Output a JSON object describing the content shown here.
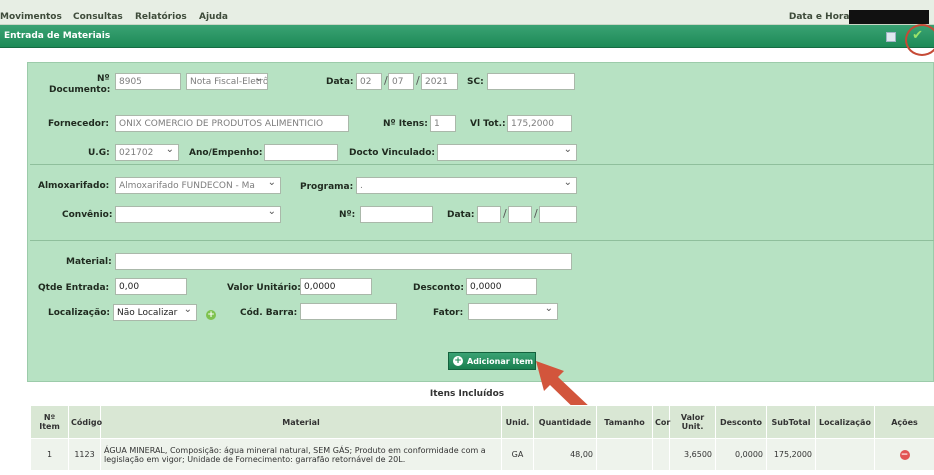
{
  "menu": {
    "items": [
      "Movimentos",
      "Consultas",
      "Relatórios",
      "Ajuda"
    ],
    "date_label": "Data e Hora:"
  },
  "window": {
    "title": "Entrada de Materiais"
  },
  "form": {
    "documento": {
      "label_num": "Nº",
      "label_doc": "Documento:",
      "value": "8905",
      "tipo": "Nota Fiscal-Eletrôr"
    },
    "data": {
      "label": "Data:",
      "dia": "02",
      "mes": "07",
      "ano": "2021"
    },
    "sc": {
      "label": "SC:",
      "value": ""
    },
    "fornecedor": {
      "label": "Fornecedor:",
      "value": "ONIX COMERCIO DE PRODUTOS ALIMENTICIO"
    },
    "n_itens": {
      "label": "Nº Itens:",
      "value": "1"
    },
    "vl_tot": {
      "label": "Vl Tot.:",
      "value": "175,2000"
    },
    "ug": {
      "label": "U.G:",
      "value": "021702"
    },
    "ano_empenho": {
      "label": "Ano/Empenho:",
      "value": ""
    },
    "docto_vinculado": {
      "label": "Docto Vinculado:",
      "value": ""
    },
    "almoxarifado": {
      "label": "Almoxarifado:",
      "value": "Almoxarifado FUNDECON - Ma"
    },
    "programa": {
      "label": "Programa:",
      "value": "."
    },
    "convenio": {
      "label": "Convênio:",
      "value": ""
    },
    "conv_num": {
      "label": "Nº:",
      "value": ""
    },
    "conv_data": {
      "label": "Data:"
    },
    "material": {
      "label": "Material:",
      "value": ""
    },
    "qtde_entrada": {
      "label": "Qtde Entrada:",
      "value": "0,00"
    },
    "valor_unitario": {
      "label": "Valor Unitário:",
      "value": "0,0000"
    },
    "desconto": {
      "label": "Desconto:",
      "value": "0,0000"
    },
    "localizacao": {
      "label": "Localização:",
      "value": "Não Localizar"
    },
    "cod_barra": {
      "label": "Cód. Barra:",
      "value": ""
    },
    "fator": {
      "label": "Fator:",
      "value": ""
    },
    "add_button": "Adicionar Item"
  },
  "itens": {
    "title": "Itens Incluídos",
    "headers": [
      "Nº Item",
      "Código",
      "Material",
      "Unid.",
      "Quantidade",
      "Tamanho",
      "Cor",
      "Valor Unit.",
      "Desconto",
      "SubTotal",
      "Localização",
      "Ações"
    ],
    "rows": [
      {
        "num": "1",
        "codigo": "1123",
        "material": "ÁGUA MINERAL, Composição: água mineral natural, SEM GÁS; Produto em conformidade com a legislação em vigor; Unidade de Fornecimento: garrafão retornável de 20L.",
        "unid": "GA",
        "quantidade": "48,00",
        "tamanho": "",
        "cor": "",
        "valor_unit": "3,6500",
        "desconto": "0,0000",
        "subtotal": "175,2000",
        "localizacao": ""
      }
    ]
  },
  "colors": {
    "accent": "#1d8a57",
    "panel": "#b7e2c3",
    "arrow": "#d2553c"
  }
}
